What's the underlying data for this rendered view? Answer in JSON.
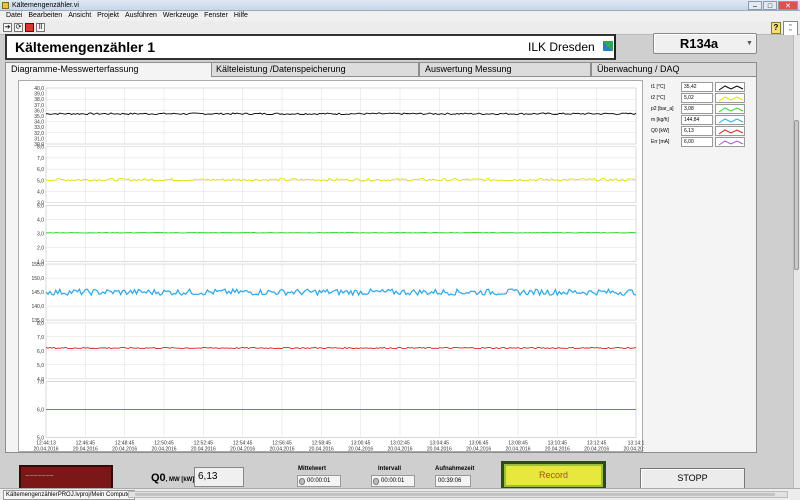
{
  "window": {
    "title": "Kältemengenzähler.vi"
  },
  "menu": [
    "Datei",
    "Bearbeiten",
    "Ansicht",
    "Projekt",
    "Ausführen",
    "Werkzeuge",
    "Fenster",
    "Hilfe"
  ],
  "header": {
    "title": "Kältemengenzähler 1",
    "org": "ILK Dresden",
    "refrigerant": "R134a"
  },
  "tabs": [
    "Diagramme-Messwerterfassung",
    "Kälteleistung /Datenspeicherung",
    "Auswertung Messung",
    "Überwachung / DAQ"
  ],
  "legend": [
    {
      "label": "t1 [°C]",
      "value": "35,42",
      "color": "#000000"
    },
    {
      "label": "t2 [°C]",
      "value": "5,02",
      "color": "#e0e000"
    },
    {
      "label": "p2 [bar_a]",
      "value": "3,08",
      "color": "#2fd52f"
    },
    {
      "label": "m [kg/h]",
      "value": "144,84",
      "color": "#2aa8e8"
    },
    {
      "label": "Q0 [kW]",
      "value": "6,13",
      "color": "#d42020"
    },
    {
      "label": "Err [mA]",
      "value": "6,00",
      "color": "#b050d8"
    }
  ],
  "chart_data": {
    "type": "line",
    "x_ticks": [
      {
        "time": "12:44:13",
        "date": "20.04.2016"
      },
      {
        "time": "12:46:45",
        "date": "20.04.2016"
      },
      {
        "time": "12:48:45",
        "date": "20.04.2016"
      },
      {
        "time": "12:50:45",
        "date": "20.04.2016"
      },
      {
        "time": "12:52:45",
        "date": "20.04.2016"
      },
      {
        "time": "12:54:45",
        "date": "20.04.2016"
      },
      {
        "time": "12:56:45",
        "date": "20.04.2016"
      },
      {
        "time": "12:58:45",
        "date": "20.04.2016"
      },
      {
        "time": "13:00:45",
        "date": "20.04.2016"
      },
      {
        "time": "13:02:45",
        "date": "20.04.2016"
      },
      {
        "time": "13:04:45",
        "date": "20.04.2016"
      },
      {
        "time": "13:06:45",
        "date": "20.04.2016"
      },
      {
        "time": "13:08:45",
        "date": "20.04.2016"
      },
      {
        "time": "13:10:45",
        "date": "20.04.2016"
      },
      {
        "time": "13:12:45",
        "date": "20.04.2016"
      },
      {
        "time": "13:14:1",
        "date": "20.04.2016"
      }
    ],
    "panels": [
      {
        "series": "t1 [°C]",
        "ylim": [
          30,
          40
        ],
        "ticks": [
          "40,0",
          "38,0",
          "36,0",
          "34,0",
          "32,0",
          "30,0"
        ],
        "minor": [
          "39,0",
          "37,0",
          "35,0",
          "33,0",
          "31,0"
        ],
        "level": 35.4,
        "noise": 0.15,
        "color": "#000000"
      },
      {
        "series": "t2 [°C]",
        "ylim": [
          3,
          8
        ],
        "ticks": [
          "8,0",
          "7,0",
          "6,0",
          "5,0",
          "4,0",
          "3,0"
        ],
        "level": 5.05,
        "noise": 0.12,
        "color": "#e0e000"
      },
      {
        "series": "p2 [bar_a]",
        "ylim": [
          1,
          5
        ],
        "ticks": [
          "5,0",
          "4,0",
          "3,0",
          "2,0",
          "1,0"
        ],
        "level": 3.05,
        "noise": 0.02,
        "color": "#2fd52f"
      },
      {
        "series": "m [kg/h]",
        "ylim": [
          135,
          155
        ],
        "ticks": [
          "155,0",
          "150,0",
          "145,0",
          "140,0",
          "135,0"
        ],
        "level": 145,
        "noise": 1.1,
        "color": "#2aa8e8"
      },
      {
        "series": "Q0 [kW]",
        "ylim": [
          4,
          8
        ],
        "ticks": [
          "8,0",
          "7,0",
          "6,0",
          "5,0",
          "4,0"
        ],
        "level": 6.2,
        "noise": 0.05,
        "color": "#d42020"
      },
      {
        "series": "Err [mA]",
        "ylim": [
          5,
          7
        ],
        "ticks": [
          "7,0",
          "6,0",
          "5,0"
        ],
        "level": 6.0,
        "noise": 0,
        "color": "#b050d8"
      }
    ]
  },
  "bottom": {
    "q0_label": "Q0",
    "q0_sub": ", MW [kW]",
    "q0_value": "6,13",
    "mittelwert_label": "Mittelwert",
    "mittelwert_value": "00:00:01",
    "intervall_label": "Intervall",
    "intervall_value": "00:00:01",
    "aufnahmezeit_label": "Aufnahmezeit",
    "aufnahmezeit_value": "00:39:06",
    "record_label": "Record",
    "stopp_label": "STOPP"
  },
  "status": {
    "project": "KältemengenzählerPROJ.lvproj/Mein Computer"
  }
}
